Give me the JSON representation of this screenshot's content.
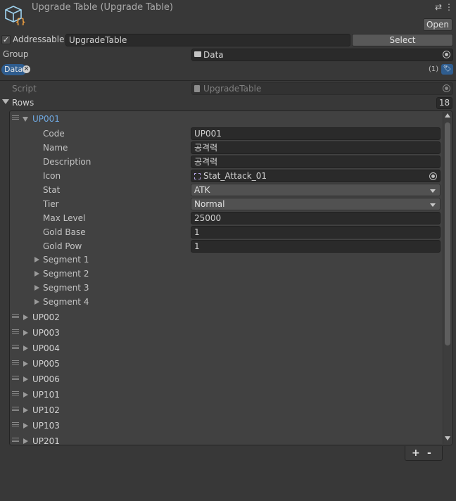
{
  "header": {
    "title": "Upgrade Table (Upgrade Table)",
    "open_label": "Open"
  },
  "addressable": {
    "label": "Addressable",
    "checked": true,
    "check_mark": "✓",
    "address": "UpgradeTable",
    "select_label": "Select"
  },
  "group": {
    "label": "Group",
    "value": "Data"
  },
  "labels": {
    "chip": "Data",
    "remove_glyph": "×",
    "count": "(1)",
    "tag_glyph": "🏷"
  },
  "script": {
    "label": "Script",
    "value": "UpgradeTable"
  },
  "rows": {
    "label": "Rows",
    "count": "18",
    "expanded_item": {
      "name": "UP001",
      "fields": [
        {
          "label": "Code",
          "value": "UP001",
          "kind": "text"
        },
        {
          "label": "Name",
          "value": "공격력",
          "kind": "text"
        },
        {
          "label": "Description",
          "value": "공격력",
          "kind": "text"
        },
        {
          "label": "Icon",
          "value": "Stat_Attack_01",
          "kind": "object"
        },
        {
          "label": "Stat",
          "value": "ATK",
          "kind": "dropdown"
        },
        {
          "label": "Tier",
          "value": "Normal",
          "kind": "dropdown"
        },
        {
          "label": "Max Level",
          "value": "25000",
          "kind": "text"
        },
        {
          "label": "Gold Base",
          "value": "1",
          "kind": "text"
        },
        {
          "label": "Gold Pow",
          "value": "1",
          "kind": "text"
        }
      ],
      "segments": [
        "Segment 1",
        "Segment 2",
        "Segment 3",
        "Segment 4"
      ]
    },
    "collapsed_items": [
      "UP002",
      "UP003",
      "UP004",
      "UP005",
      "UP006",
      "UP101",
      "UP102",
      "UP103",
      "UP201"
    ]
  },
  "footer": {
    "add_label": "+",
    "remove_label": "-"
  },
  "colors": {
    "background": "#383838",
    "accent_blue": "#2f5d8f",
    "selected_text": "#6fa8e0"
  }
}
